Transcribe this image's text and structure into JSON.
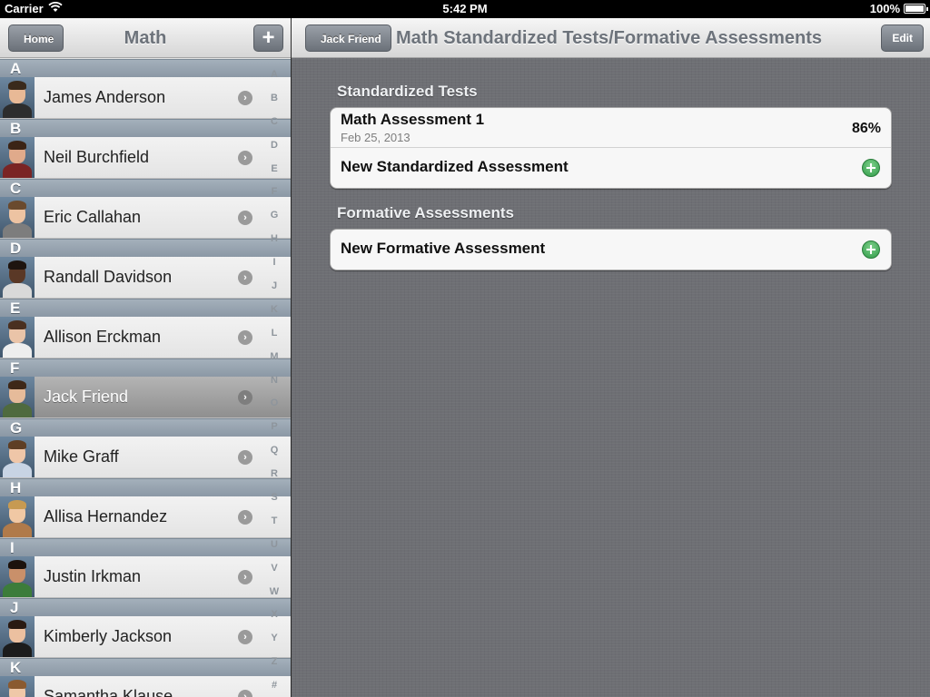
{
  "status_bar": {
    "carrier": "Carrier",
    "time": "5:42 PM",
    "battery": "100%"
  },
  "master": {
    "title": "Math",
    "back_label": "Home",
    "add_label": "+",
    "sections": [
      {
        "letter": "A",
        "name": "James Anderson",
        "skin": "#e8b996",
        "hair": "#3a2a1c",
        "shirt": "#2d2d2d",
        "selected": false
      },
      {
        "letter": "B",
        "name": "Neil Burchfield",
        "skin": "#e0aa8b",
        "hair": "#3b2416",
        "shirt": "#7a2424",
        "selected": false
      },
      {
        "letter": "C",
        "name": "Eric Callahan",
        "skin": "#edc3a2",
        "hair": "#6a4a2e",
        "shirt": "#7d7d7d",
        "selected": false
      },
      {
        "letter": "D",
        "name": "Randall Davidson",
        "skin": "#5a3826",
        "hair": "#1e140f",
        "shirt": "#d9d9d9",
        "selected": false
      },
      {
        "letter": "E",
        "name": "Allison Erckman",
        "skin": "#eac4a8",
        "hair": "#4a3020",
        "shirt": "#eeeeee",
        "selected": false
      },
      {
        "letter": "F",
        "name": "Jack Friend",
        "skin": "#e6bb9a",
        "hair": "#3e2818",
        "shirt": "#4f6a3e",
        "selected": true
      },
      {
        "letter": "G",
        "name": "Mike Graff",
        "skin": "#efc6a8",
        "hair": "#5e3e24",
        "shirt": "#c8d4e4",
        "selected": false
      },
      {
        "letter": "H",
        "name": "Allisa Hernandez",
        "skin": "#f0c8a4",
        "hair": "#c79a52",
        "shirt": "#b07a4a",
        "selected": false
      },
      {
        "letter": "I",
        "name": "Justin Irkman",
        "skin": "#c9906a",
        "hair": "#1c120c",
        "shirt": "#3c7c3a",
        "selected": false
      },
      {
        "letter": "J",
        "name": "Kimberly Jackson",
        "skin": "#ecc0a0",
        "hair": "#2a1a12",
        "shirt": "#1c1c1c",
        "selected": false
      },
      {
        "letter": "K",
        "name": "Samantha Klause",
        "skin": "#efc8a8",
        "hair": "#8a5a30",
        "shirt": "#5a3a2a",
        "selected": false
      }
    ],
    "index_letters": [
      "A",
      "B",
      "C",
      "D",
      "E",
      "F",
      "G",
      "H",
      "I",
      "J",
      "K",
      "L",
      "M",
      "N",
      "O",
      "P",
      "Q",
      "R",
      "S",
      "T",
      "U",
      "V",
      "W",
      "X",
      "Y",
      "Z",
      "#"
    ]
  },
  "detail": {
    "back_label": "Jack Friend",
    "title": "Math Standardized Tests/Formative Assessments",
    "edit_label": "Edit",
    "standardized": {
      "heading": "Standardized Tests",
      "assessment": {
        "title": "Math Assessment 1",
        "date": "Feb 25, 2013",
        "score": "86%"
      },
      "new_label": "New Standardized Assessment"
    },
    "formative": {
      "heading": "Formative Assessments",
      "new_label": "New Formative Assessment"
    }
  },
  "colors": {
    "section_header": "#95a2ae",
    "selected_row": "#a0a0a0",
    "add_green": "#2f9a48",
    "background": "#6e6f74"
  }
}
